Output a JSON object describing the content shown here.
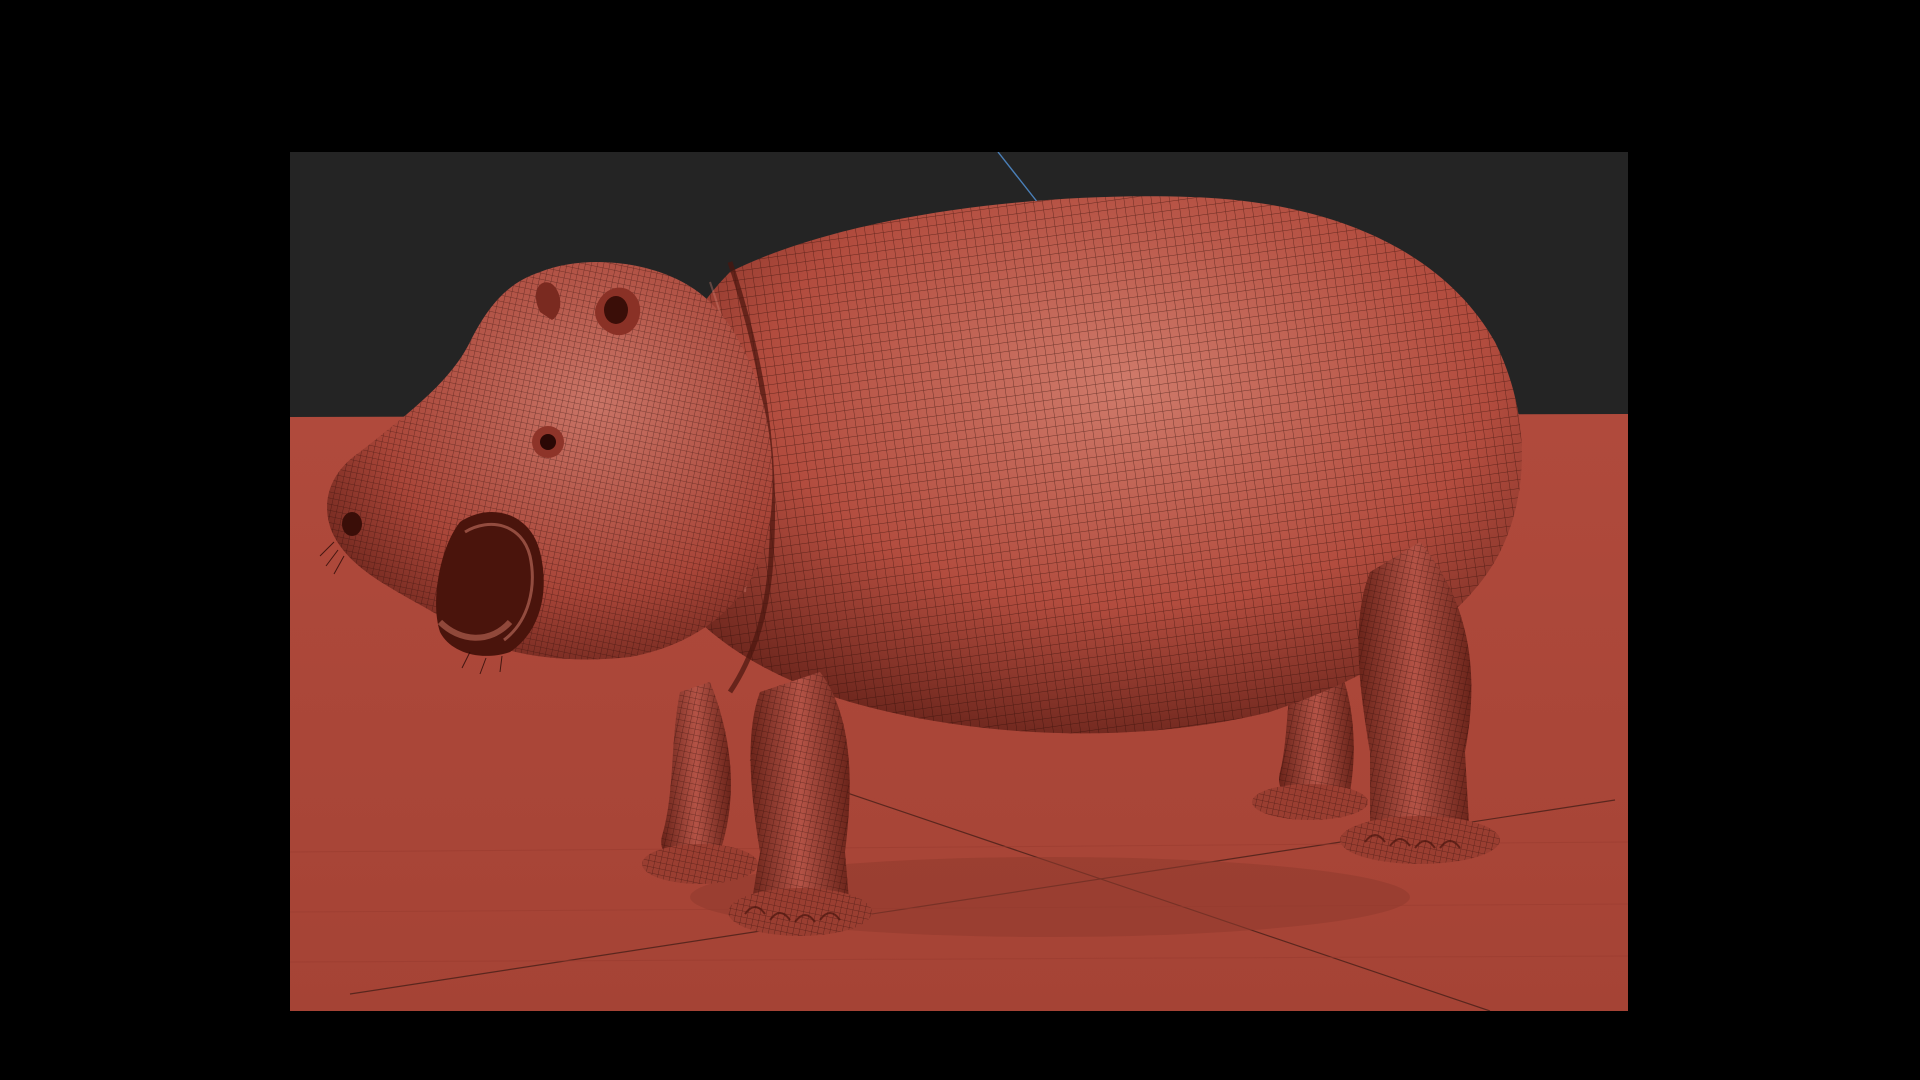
{
  "scene": {
    "subject": "hippopotamus-wireframe-model",
    "colors": {
      "letterbox": "#000000",
      "sky": "#242424",
      "ground": "#b04a3c",
      "ground_shadow": "#8f3a2e",
      "model_base": "#b24c3e",
      "model_light": "#cf7a6a",
      "model_shadow": "#5a1c14",
      "wire": "#2a0a06",
      "grid_line": "#3a1a14",
      "axis_blue": "#4a7fb8"
    }
  }
}
